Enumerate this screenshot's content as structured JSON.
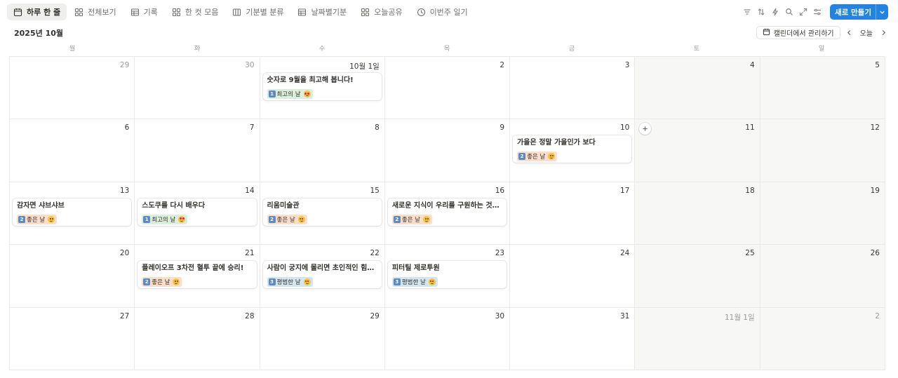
{
  "toolbar": {
    "tabs": [
      {
        "label": "하루 한 줄",
        "icon": "calendar-icon"
      },
      {
        "label": "전체보기",
        "icon": "gallery-icon"
      },
      {
        "label": "기록",
        "icon": "table-icon"
      },
      {
        "label": "한 컷 모음",
        "icon": "gallery-icon"
      },
      {
        "label": "기분별 분류",
        "icon": "board-icon"
      },
      {
        "label": "날짜별기분",
        "icon": "table-icon"
      },
      {
        "label": "오늘공유",
        "icon": "gallery-icon"
      },
      {
        "label": "이번주 일기",
        "icon": "clock-icon"
      }
    ],
    "new_button_label": "새로 만들기"
  },
  "header": {
    "month_title": "2025년 10월",
    "manage_calendar_label": "캘린더에서 관리하기",
    "today_label": "오늘"
  },
  "weekdays": [
    "월",
    "화",
    "수",
    "목",
    "금",
    "토",
    "일"
  ],
  "mood_tags": {
    "best": {
      "number": "1",
      "label": "최고의 날",
      "color": "#dbeddb"
    },
    "good": {
      "number": "2",
      "label": "좋은 날",
      "color": "#fadec9"
    },
    "normal": {
      "number": "3",
      "label": "평범한 날",
      "color": "#d3e5ef"
    }
  },
  "weeks": [
    [
      {
        "date": "29",
        "muted": true
      },
      {
        "date": "30",
        "muted": true
      },
      {
        "date": "10월 1일",
        "event": {
          "title": "숫자로 9월을 최고해 봅니다!",
          "mood": "best"
        }
      },
      {
        "date": "2"
      },
      {
        "date": "3"
      },
      {
        "date": "4"
      },
      {
        "date": "5"
      }
    ],
    [
      {
        "date": "6"
      },
      {
        "date": "7"
      },
      {
        "date": "8"
      },
      {
        "date": "9"
      },
      {
        "date": "10",
        "event": {
          "title": "가을은 정말 가을인가 보다",
          "mood": "good"
        }
      },
      {
        "date": "11",
        "add_button": true
      },
      {
        "date": "12"
      }
    ],
    [
      {
        "date": "13",
        "event": {
          "title": "감자면 샤브샤브",
          "mood": "good"
        }
      },
      {
        "date": "14",
        "event": {
          "title": "스도쿠를 다시 배우다",
          "mood": "best"
        }
      },
      {
        "date": "15",
        "event": {
          "title": "리움미술관",
          "mood": "good"
        }
      },
      {
        "date": "16",
        "event": {
          "title": "새로운 지식이 우리를 구원하는 것이 ...",
          "mood": "good"
        }
      },
      {
        "date": "17"
      },
      {
        "date": "18"
      },
      {
        "date": "19"
      }
    ],
    [
      {
        "date": "20"
      },
      {
        "date": "21",
        "event": {
          "title": "플레이오프 3차전 혈투 끝에 승리!",
          "mood": "good"
        }
      },
      {
        "date": "22",
        "event": {
          "title": "사람이 궁지에 몰리면 초인적인 힘이 ...",
          "mood": "normal"
        }
      },
      {
        "date": "23",
        "event": {
          "title": "피터틸 제로투원",
          "mood": "normal"
        }
      },
      {
        "date": "24"
      },
      {
        "date": "25"
      },
      {
        "date": "26"
      }
    ],
    [
      {
        "date": "27"
      },
      {
        "date": "28"
      },
      {
        "date": "29"
      },
      {
        "date": "30"
      },
      {
        "date": "31"
      },
      {
        "date": "11월 1일",
        "muted": true
      },
      {
        "date": "2",
        "muted": true
      }
    ]
  ]
}
